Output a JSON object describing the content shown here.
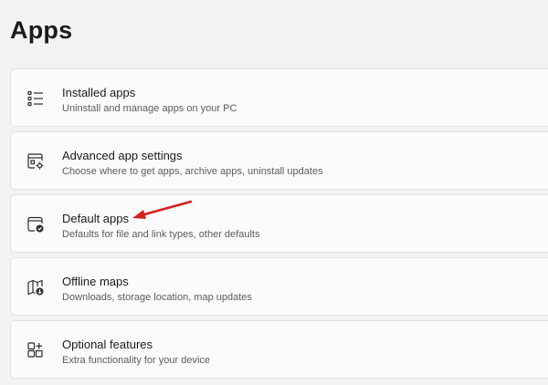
{
  "page": {
    "title": "Apps"
  },
  "items": [
    {
      "title": "Installed apps",
      "description": "Uninstall and manage apps on your PC",
      "icon": "list-icon"
    },
    {
      "title": "Advanced app settings",
      "description": "Choose where to get apps, archive apps, uninstall updates",
      "icon": "app-settings-icon"
    },
    {
      "title": "Default apps",
      "description": "Defaults for file and link types, other defaults",
      "icon": "default-apps-icon"
    },
    {
      "title": "Offline maps",
      "description": "Downloads, storage location, map updates",
      "icon": "map-download-icon"
    },
    {
      "title": "Optional features",
      "description": "Extra functionality for your device",
      "icon": "grid-add-icon"
    }
  ],
  "annotation": {
    "arrow_color": "#d42020",
    "target": "Default apps"
  }
}
